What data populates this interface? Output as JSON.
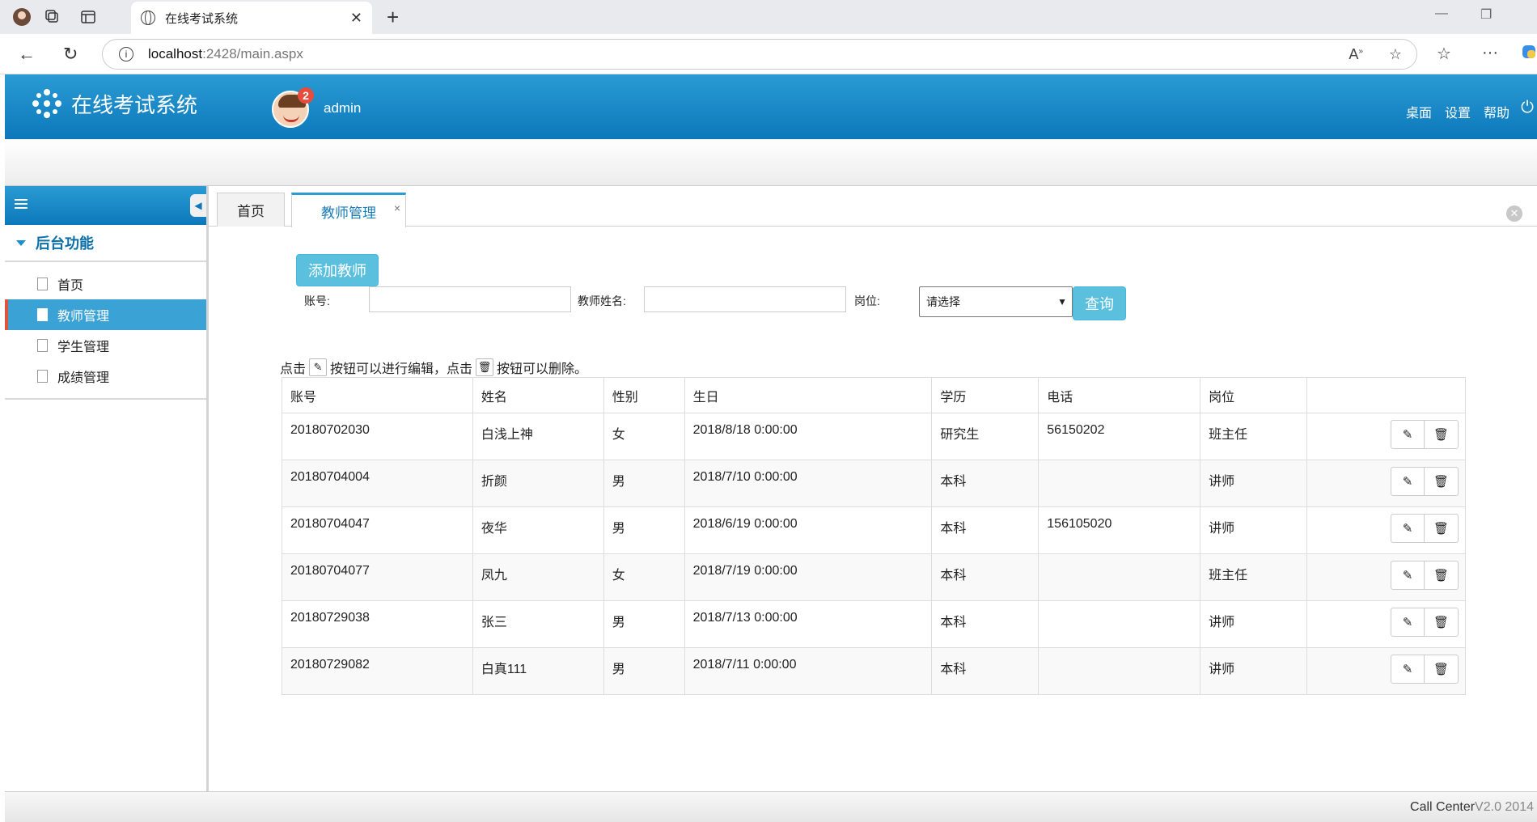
{
  "browser": {
    "tab_title": "在线考试系统",
    "url_host": "localhost",
    "url_path": ":2428/main.aspx"
  },
  "header": {
    "app_title": "在线考试系统",
    "notification_count": "2",
    "username": "admin",
    "links": [
      "桌面",
      "设置",
      "帮助"
    ]
  },
  "sidebar": {
    "section_title": "后台功能",
    "items": [
      {
        "label": "首页"
      },
      {
        "label": "教师管理"
      },
      {
        "label": "学生管理"
      },
      {
        "label": "成绩管理"
      }
    ]
  },
  "tabs": {
    "home": "首页",
    "active": "教师管理"
  },
  "toolbar": {
    "add_label": "添加教师",
    "account_label": "账号:",
    "account_value": "",
    "name_label": "教师姓名:",
    "name_value": "",
    "position_label": "岗位:",
    "position_selected": "请选择",
    "query_label": "查询"
  },
  "hint": {
    "part1": "点击",
    "part2": "按钮可以进行编辑，点击",
    "part3": "按钮可以删除。"
  },
  "table": {
    "headers": [
      "账号",
      "姓名",
      "性别",
      "生日",
      "学历",
      "电话",
      "岗位",
      ""
    ],
    "rows": [
      [
        "20180702030",
        "白浅上神",
        "女",
        "2018/8/18 0:00:00",
        "研究生",
        "56150202",
        "班主任"
      ],
      [
        "20180704004",
        "折颜",
        "男",
        "2018/7/10 0:00:00",
        "本科",
        "",
        "讲师"
      ],
      [
        "20180704047",
        "夜华",
        "男",
        "2018/6/19 0:00:00",
        "本科",
        "156105020",
        "讲师"
      ],
      [
        "20180704077",
        "凤九",
        "女",
        "2018/7/19 0:00:00",
        "本科",
        "",
        "班主任"
      ],
      [
        "20180729038",
        "张三",
        "男",
        "2018/7/13 0:00:00",
        "本科",
        "",
        "讲师"
      ],
      [
        "20180729082",
        "白真111",
        "男",
        "2018/7/11 0:00:00",
        "本科",
        "",
        "讲师"
      ]
    ]
  },
  "footer": {
    "brand": "Call Center",
    "version": "V2.0 2014"
  },
  "colors": {
    "header_blue": "#0c78bb",
    "accent_cyan": "#5bc0de",
    "active_item": "#3ba2d6"
  }
}
